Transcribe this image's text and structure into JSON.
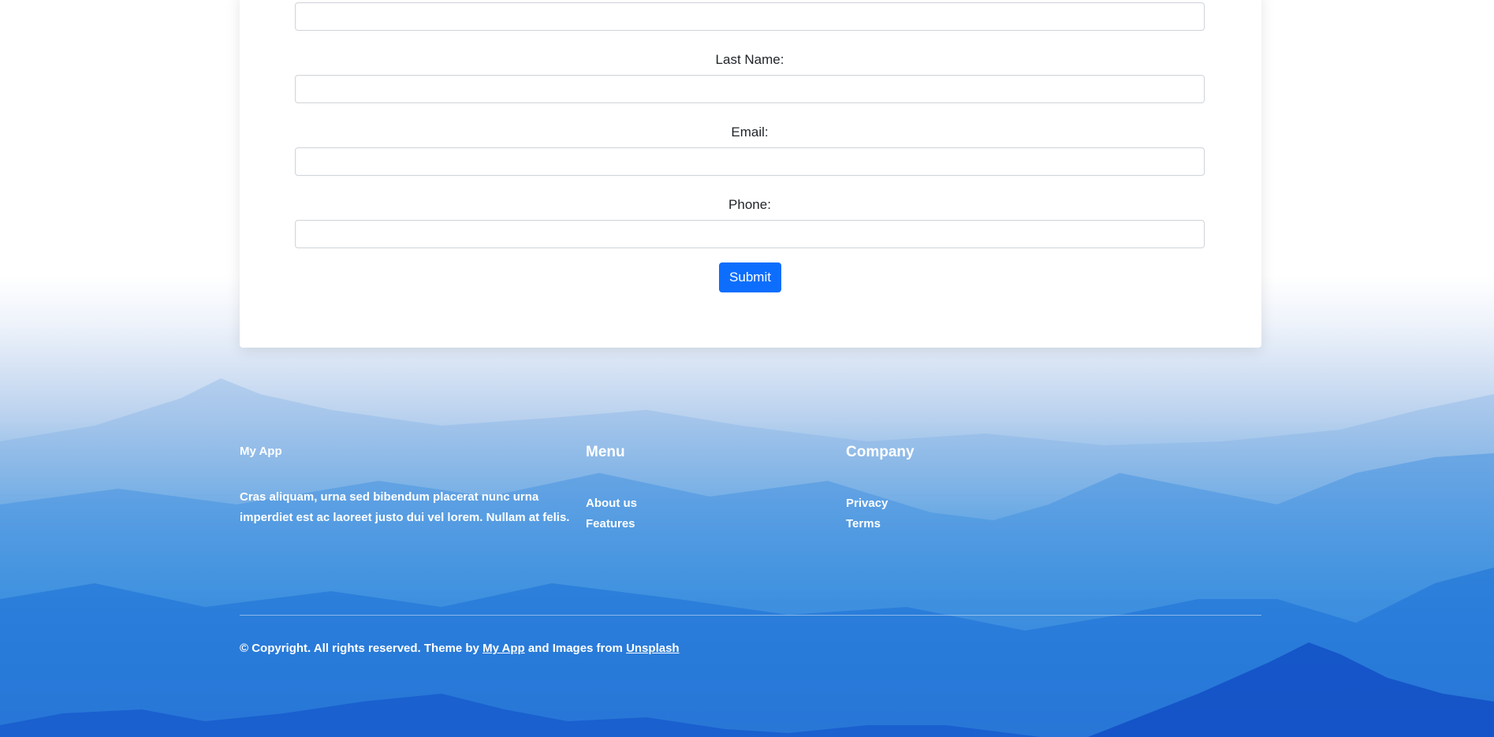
{
  "form": {
    "first_name_value": "",
    "last_name_label": "Last Name:",
    "last_name_value": "",
    "email_label": "Email:",
    "email_value": "",
    "phone_label": "Phone:",
    "phone_value": "",
    "submit_label": "Submit"
  },
  "footer": {
    "brand": "My App",
    "about_text": "Cras aliquam, urna sed bibendum placerat nunc urna imperdiet est ac laoreet justo dui vel lorem. Nullam at felis.",
    "menu": {
      "heading": "Menu",
      "items": [
        {
          "label": "About us"
        },
        {
          "label": "Features"
        }
      ]
    },
    "company": {
      "heading": "Company",
      "items": [
        {
          "label": "Privacy"
        },
        {
          "label": "Terms"
        }
      ]
    },
    "copyright": {
      "prefix": "© Copyright. All rights reserved. Theme by ",
      "theme_link": "My App",
      "middle": " and Images from ",
      "images_link": "Unsplash"
    }
  },
  "colors": {
    "primary_button": "#0d6efd",
    "footer_text": "#ffffff",
    "input_border": "#ced4da"
  }
}
